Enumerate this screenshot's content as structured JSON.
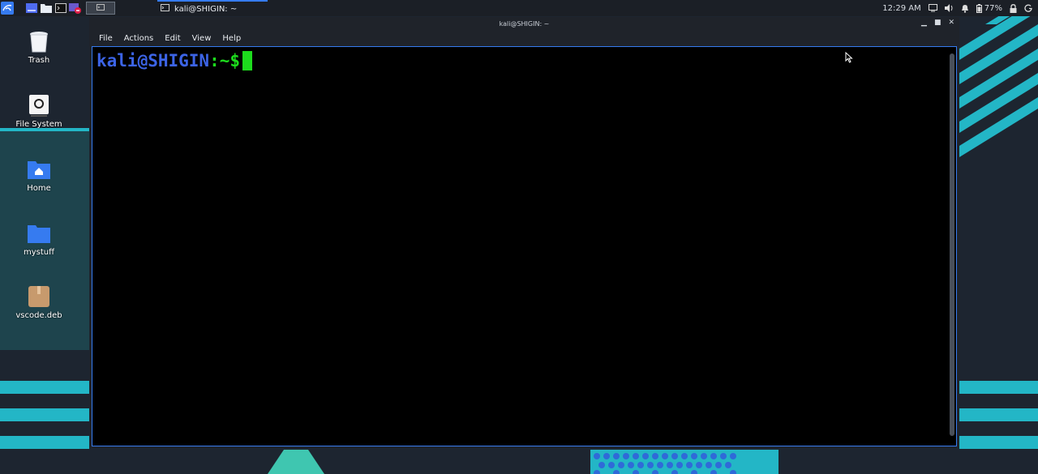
{
  "colors": {
    "accent": "#367bf0",
    "teal": "#23b6c6",
    "prompt_user": "#3c64e6",
    "prompt_path": "#1ddc1d",
    "cursor": "#1ddc1d"
  },
  "panel": {
    "launcher_icons": [
      "kali-menu-icon",
      "show-desktop-icon",
      "file-manager-icon",
      "terminal-icon",
      "record-icon"
    ],
    "workspace_icon": "terminal-icon",
    "task_title": "kali@SHIGIN: ~",
    "clock": "12:29 AM",
    "battery": "77%"
  },
  "desktop_icons": [
    {
      "label": "Trash",
      "icon": "trash-icon"
    },
    {
      "label": "File System",
      "icon": "drive-icon"
    },
    {
      "label": "Home",
      "icon": "home-folder-icon"
    },
    {
      "label": "mystuff",
      "icon": "folder-icon"
    },
    {
      "label": "vscode.deb",
      "icon": "deb-package-icon"
    }
  ],
  "window": {
    "title": "kali@SHIGIN: ~",
    "menu": [
      "File",
      "Actions",
      "Edit",
      "View",
      "Help"
    ],
    "prompt_user": "kali@SHIGIN",
    "prompt_path": ":~$"
  }
}
